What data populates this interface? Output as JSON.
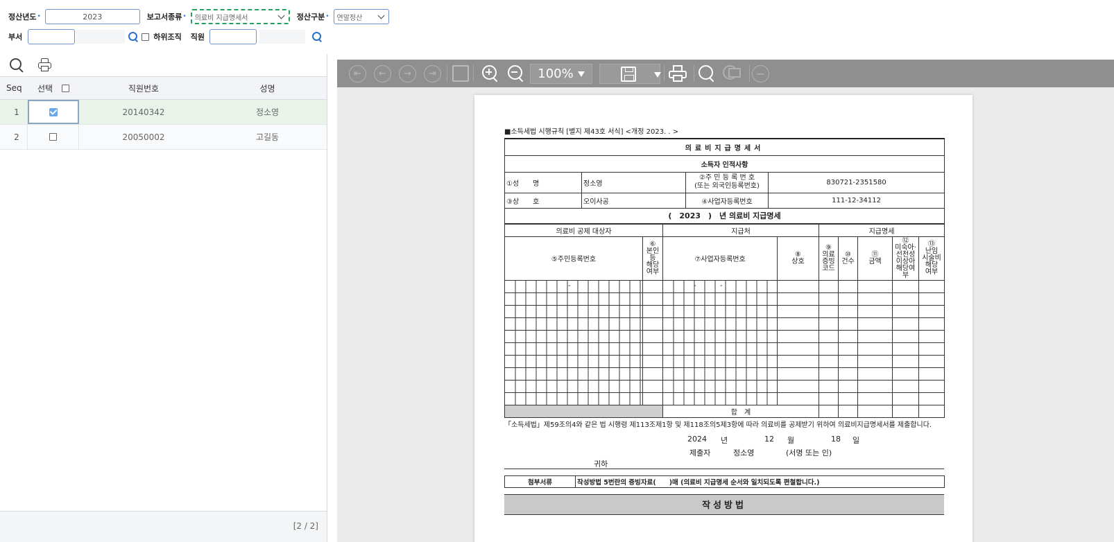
{
  "filters": {
    "year_label": "정산년도",
    "year_value": "2023",
    "report_label": "보고서종류",
    "report_value": "의료비 지급명세서",
    "calc_label": "정산구분",
    "calc_value": "연말정산",
    "dept_label": "부서",
    "sub_org_label": "하위조직",
    "emp_label": "직원",
    "required_mark": "•"
  },
  "grid": {
    "headers": {
      "seq": "Seq",
      "select": "선택",
      "emp_no": "직원번호",
      "name": "성명"
    },
    "rows": [
      {
        "seq": "1",
        "checked": true,
        "emp_no": "20140342",
        "name": "정소영"
      },
      {
        "seq": "2",
        "checked": false,
        "emp_no": "20050002",
        "name": "고길동"
      }
    ],
    "pager": "[2 / 2]"
  },
  "viewer": {
    "zoom": "100%"
  },
  "doc": {
    "ref": "■소득세법 시행규칙 [별지 제43호 서식] <개정 2023. . >",
    "title": "의료비지급명세서",
    "income_section": "소득자 인적사항",
    "name_label": "①성　　명",
    "name_value": "정소영",
    "rrn_label": "②주 민 등 록 번 호",
    "rrn_label2": "(또는 외국인등록번호)",
    "rrn_value": "830721-2351580",
    "company_label": "③상　　호",
    "company_value": "오이사공",
    "biz_label": "④사업자등록번호",
    "biz_value": "111-12-34112",
    "year_title": "(　2023　)　년 의료비 지급명세",
    "col_target": "의료비 공제 대상자",
    "col_payee": "지급처",
    "col_detail": "지급명세",
    "h5": "⑤주민등록번호",
    "h6": "⑥",
    "h6b": "본인등",
    "h6c": "해당여부",
    "h7": "⑦사업자등록번호",
    "h8": "⑧",
    "h8b": "상호",
    "h9": "⑨",
    "h9b": "의료",
    "h9c": "증빙",
    "h9d": "코드",
    "h10": "⑩",
    "h10b": "건수",
    "h11": "⑪",
    "h11b": "금액",
    "h12": "⑫",
    "h12b": "미숙아·선천성",
    "h12c": "이상아",
    "h12d": "해당여부",
    "h13": "⑬",
    "h13b": "난임",
    "h13c": "시술비",
    "h13d": "해당",
    "h13e": "여부",
    "dash": "-",
    "total": "합　계",
    "decl": "「소득세법」제59조의4와 같은 법 시행령 제113조제1항 및 제118조의5제3항에 따라 의료비를 공제받기 위하여 의료비지급명세서를 제출합니다.",
    "date_year": "2024",
    "date_year_unit": "년",
    "date_month": "12",
    "date_month_unit": "월",
    "date_day": "18",
    "date_day_unit": "일",
    "submitter_label": "제출자",
    "submitter_value": "정소영",
    "sign_label": "(서명 또는 인)",
    "to_label": "귀하",
    "attach_label": "첨부서류",
    "attach_text": "작성방법 5번란의 증빙자료(　　)매 (의료비 지급명세 순서와 일치되도록 편철합니다.)",
    "method_title": "작성방법"
  }
}
